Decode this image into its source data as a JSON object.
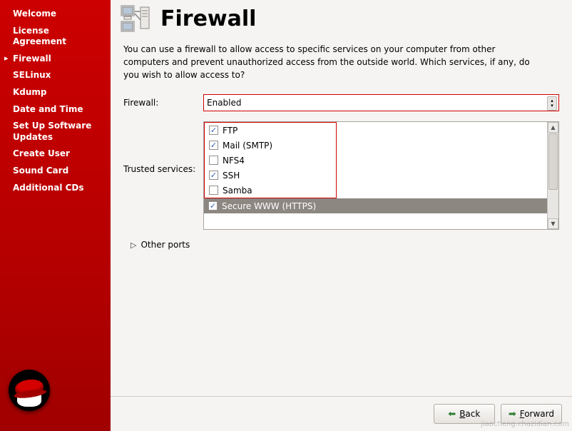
{
  "sidebar": {
    "items": [
      {
        "label": "Welcome",
        "active": false
      },
      {
        "label": "License Agreement",
        "active": false
      },
      {
        "label": "Firewall",
        "active": true
      },
      {
        "label": "SELinux",
        "active": false
      },
      {
        "label": "Kdump",
        "active": false
      },
      {
        "label": "Date and Time",
        "active": false
      },
      {
        "label": "Set Up Software Updates",
        "active": false
      },
      {
        "label": "Create User",
        "active": false
      },
      {
        "label": "Sound Card",
        "active": false
      },
      {
        "label": "Additional CDs",
        "active": false
      }
    ]
  },
  "header": {
    "title": "Firewall",
    "icon": "firewall-computers-icon"
  },
  "description": "You can use a firewall to allow access to specific services on your computer from other computers and prevent unauthorized access from the outside world.  Which services, if any, do you wish to allow access to?",
  "firewall": {
    "label": "Firewall:",
    "value": "Enabled"
  },
  "trusted": {
    "label": "Trusted services:",
    "services": [
      {
        "name": "FTP",
        "checked": true,
        "selected": false
      },
      {
        "name": "Mail (SMTP)",
        "checked": true,
        "selected": false
      },
      {
        "name": "NFS4",
        "checked": false,
        "selected": false
      },
      {
        "name": "SSH",
        "checked": true,
        "selected": false
      },
      {
        "name": "Samba",
        "checked": false,
        "selected": false
      },
      {
        "name": "Secure WWW (HTTPS)",
        "checked": true,
        "selected": true
      }
    ]
  },
  "expander": {
    "label": "Other ports"
  },
  "footer": {
    "back_label": "Back",
    "back_underline": "B",
    "forward_label": "Forward",
    "forward_underline": "F"
  },
  "watermark": "jiaocheng.chazidian.com"
}
